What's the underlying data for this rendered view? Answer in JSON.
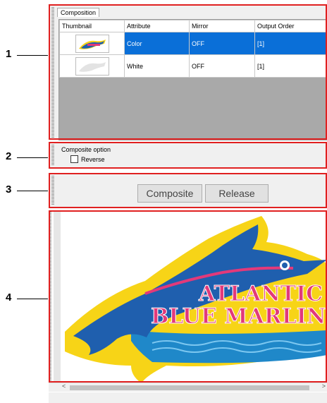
{
  "callouts": [
    "1",
    "2",
    "3",
    "4"
  ],
  "composition": {
    "tab_label": "Composition",
    "columns": [
      "Thumbnail",
      "Attribute",
      "Mirror",
      "Output Order"
    ],
    "rows": [
      {
        "attribute": "Color",
        "mirror": "OFF",
        "output_order": "[1]",
        "selected": true
      },
      {
        "attribute": "White",
        "mirror": "OFF",
        "output_order": "[1]",
        "selected": false
      }
    ]
  },
  "composite_option": {
    "label": "Composite option",
    "reverse_label": "Reverse",
    "reverse_checked": false
  },
  "actions": {
    "composite_label": "Composite",
    "release_label": "Release"
  },
  "preview": {
    "title_line1": "ATLANTIC",
    "title_line2": "BLUE MARLIN"
  },
  "scrollbar": {
    "left_arrow": "<",
    "right_arrow": ">"
  },
  "colors": {
    "accent": "#e02020",
    "selection": "#0a6fd8",
    "marlin_blue": "#1f5fae",
    "outline_yellow": "#f7d417",
    "text_pink": "#e2397a"
  }
}
